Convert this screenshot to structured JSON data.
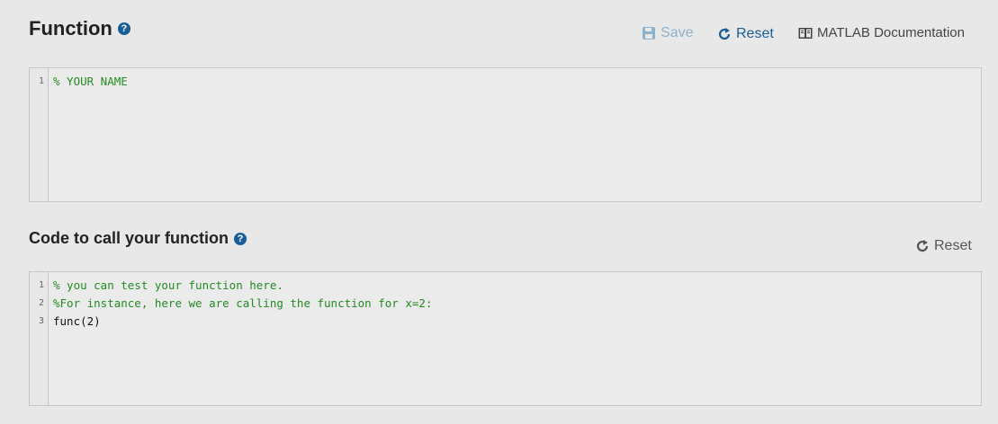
{
  "function_section": {
    "title": "Function",
    "help_icon": "question-circle-icon",
    "toolbar": {
      "save_label": "Save",
      "reset_label": "Reset",
      "docs_label": "MATLAB Documentation"
    },
    "editor": {
      "lines": [
        {
          "num": "1",
          "text": "% YOUR NAME",
          "kind": "comment"
        }
      ]
    }
  },
  "call_section": {
    "title": "Code to call your function",
    "help_icon": "question-circle-icon",
    "reset_label": "Reset",
    "editor": {
      "lines": [
        {
          "num": "1",
          "text": "% you can test your function here.",
          "kind": "comment"
        },
        {
          "num": "2",
          "text": "%For instance, here we are calling the function for x=2:",
          "kind": "comment"
        },
        {
          "num": "3",
          "text": "func(2)",
          "kind": "plain"
        }
      ]
    }
  },
  "colors": {
    "accent": "#1a5e96",
    "save_disabled": "#8fb2cc",
    "comment": "#228b22",
    "background": "#e8e8e8"
  }
}
